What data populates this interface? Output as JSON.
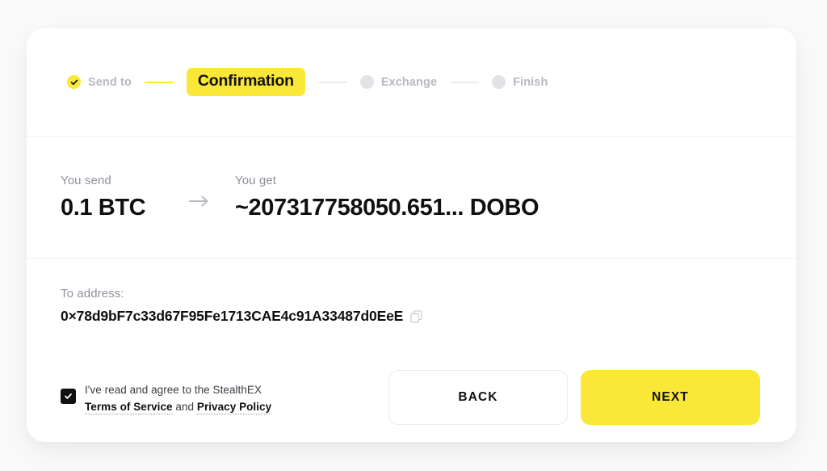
{
  "theme": {
    "accent": "#FAE838",
    "background": "#FAFAFB",
    "card_background": "#FFFFFF",
    "text_primary": "#101012",
    "text_muted": "#8F9199",
    "step_inactive": "#B7B9C0",
    "divider": "#F0F0F2"
  },
  "stepper": {
    "steps": [
      {
        "label": "Send to",
        "state": "completed",
        "icon": "check-circle-icon"
      },
      {
        "label": "Confirmation",
        "state": "current",
        "icon": ""
      },
      {
        "label": "Exchange",
        "state": "upcoming",
        "icon": "dot-icon"
      },
      {
        "label": "Finish",
        "state": "upcoming",
        "icon": "dot-icon"
      }
    ]
  },
  "exchange": {
    "send_label": "You send",
    "send_value": "0.1 BTC",
    "arrow_icon": "arrow-right-icon",
    "get_label": "You get",
    "get_value": "~207317758050.651... DOBO"
  },
  "address": {
    "label": "To address:",
    "value": "0×78d9bF7c33d67F95Fe1713CAE4c91A33487d0EeE",
    "copy_icon": "copy-icon"
  },
  "terms": {
    "checked": true,
    "line1": "I've read and agree to the StealthEX",
    "terms_link": "Terms of Service",
    "conjunction": " and ",
    "privacy_link": "Privacy Policy"
  },
  "buttons": {
    "back_label": "BACK",
    "next_label": "NEXT"
  }
}
